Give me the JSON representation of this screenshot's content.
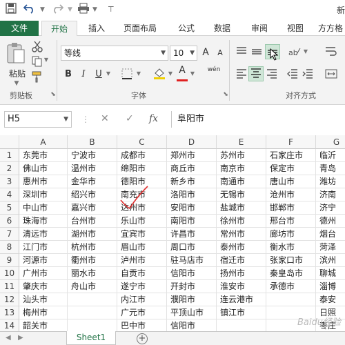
{
  "title_bar": {
    "title": "新"
  },
  "ribbon": {
    "tabs": [
      {
        "label": "文件"
      },
      {
        "label": "开始"
      },
      {
        "label": "插入"
      },
      {
        "label": "页面布局"
      },
      {
        "label": "公式"
      },
      {
        "label": "数据"
      },
      {
        "label": "审阅"
      },
      {
        "label": "视图"
      },
      {
        "label": "方方格"
      }
    ],
    "clipboard": {
      "paste_label": "粘贴",
      "group_label": "剪贴板"
    },
    "font": {
      "font_name": "等线",
      "font_size": "10",
      "group_label": "字体",
      "bold": "B",
      "italic": "I",
      "underline": "U",
      "grow": "A",
      "shrink": "A",
      "font_color": "A",
      "phonetic": "wén"
    },
    "alignment": {
      "group_label": "对齐方式"
    }
  },
  "formula_bar": {
    "name_box": "H5",
    "fx": "fx",
    "cancel": "✕",
    "confirm": "✓",
    "content": "阜阳市"
  },
  "grid": {
    "columns": [
      "A",
      "B",
      "C",
      "D",
      "E",
      "F",
      "G"
    ],
    "rows": [
      {
        "num": "1",
        "cells": [
          "东莞市",
          "宁波市",
          "成都市",
          "郑州市",
          "苏州市",
          "石家庄市",
          "临沂"
        ]
      },
      {
        "num": "2",
        "cells": [
          "佛山市",
          "温州市",
          "绵阳市",
          "商丘市",
          "南京市",
          "保定市",
          "青岛"
        ]
      },
      {
        "num": "3",
        "cells": [
          "惠州市",
          "金华市",
          "德阳市",
          "新乡市",
          "南通市",
          "唐山市",
          "潍坊"
        ]
      },
      {
        "num": "4",
        "cells": [
          "深圳市",
          "绍兴市",
          "南充市",
          "洛阳市",
          "无锡市",
          "沧州市",
          "济南"
        ]
      },
      {
        "num": "5",
        "cells": [
          "中山市",
          "嘉兴市",
          "达州市",
          "安阳市",
          "盐城市",
          "邯郸市",
          "济宁"
        ]
      },
      {
        "num": "6",
        "cells": [
          "珠海市",
          "台州市",
          "乐山市",
          "南阳市",
          "徐州市",
          "邢台市",
          "德州"
        ]
      },
      {
        "num": "7",
        "cells": [
          "清远市",
          "湖州市",
          "宜宾市",
          "许昌市",
          "常州市",
          "廊坊市",
          "烟台"
        ]
      },
      {
        "num": "8",
        "cells": [
          "江门市",
          "杭州市",
          "眉山市",
          "周口市",
          "泰州市",
          "衡水市",
          "菏泽"
        ]
      },
      {
        "num": "9",
        "cells": [
          "河源市",
          "衢州市",
          "泸州市",
          "驻马店市",
          "宿迁市",
          "张家口市",
          "滨州"
        ]
      },
      {
        "num": "10",
        "cells": [
          "广州市",
          "丽水市",
          "自贡市",
          "信阳市",
          "扬州市",
          "秦皇岛市",
          "聊城"
        ]
      },
      {
        "num": "11",
        "cells": [
          "肇庆市",
          "舟山市",
          "遂宁市",
          "开封市",
          "淮安市",
          "承德市",
          "淄博"
        ]
      },
      {
        "num": "12",
        "cells": [
          "汕头市",
          "",
          "内江市",
          "濮阳市",
          "连云港市",
          "",
          "泰安"
        ]
      },
      {
        "num": "13",
        "cells": [
          "梅州市",
          "",
          "广元市",
          "平顶山市",
          "镇江市",
          "",
          "日照"
        ]
      },
      {
        "num": "14",
        "cells": [
          "韶关市",
          "",
          "巴中市",
          "信阳市",
          "",
          "",
          "枣庄"
        ]
      }
    ]
  },
  "sheets": {
    "active": "Sheet1",
    "add": "+"
  },
  "watermark": "Baidu经验",
  "colors": {
    "accent": "#217346",
    "selection": "#cfe6d7",
    "annotation": "#e03030"
  }
}
